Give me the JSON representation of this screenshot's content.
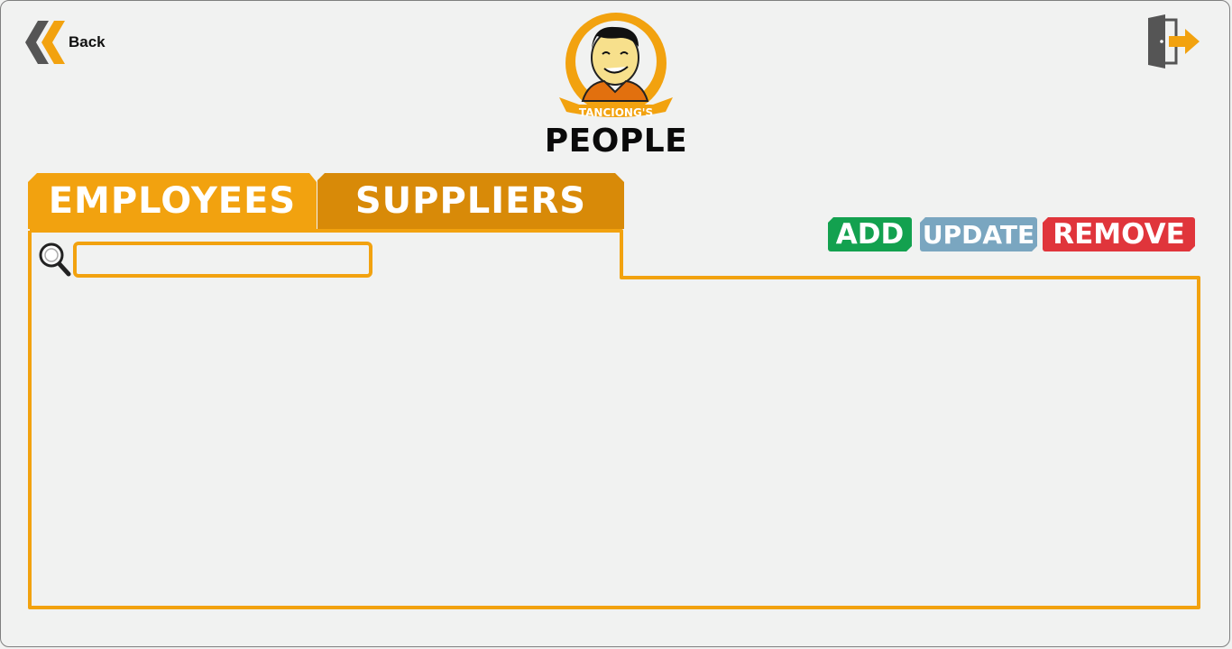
{
  "header": {
    "back_label": "Back",
    "page_title": "PEOPLE",
    "logo_text": "TANCIONG'S"
  },
  "tabs": [
    {
      "label": "EMPLOYEES",
      "active": true
    },
    {
      "label": "SUPPLIERS",
      "active": false
    }
  ],
  "search": {
    "value": "",
    "placeholder": ""
  },
  "actions": {
    "add_label": "ADD",
    "update_label": "UPDATE",
    "remove_label": "REMOVE"
  },
  "icons": [
    "back-chevron-icon",
    "logout-door-icon",
    "search-icon",
    "logo-mascot-icon"
  ],
  "colors": {
    "accent": "#f2a20f",
    "accent_dark": "#d88a08",
    "add": "#13a14f",
    "update": "#7aa6c0",
    "remove": "#e0353b",
    "background": "#f1f2f1"
  }
}
